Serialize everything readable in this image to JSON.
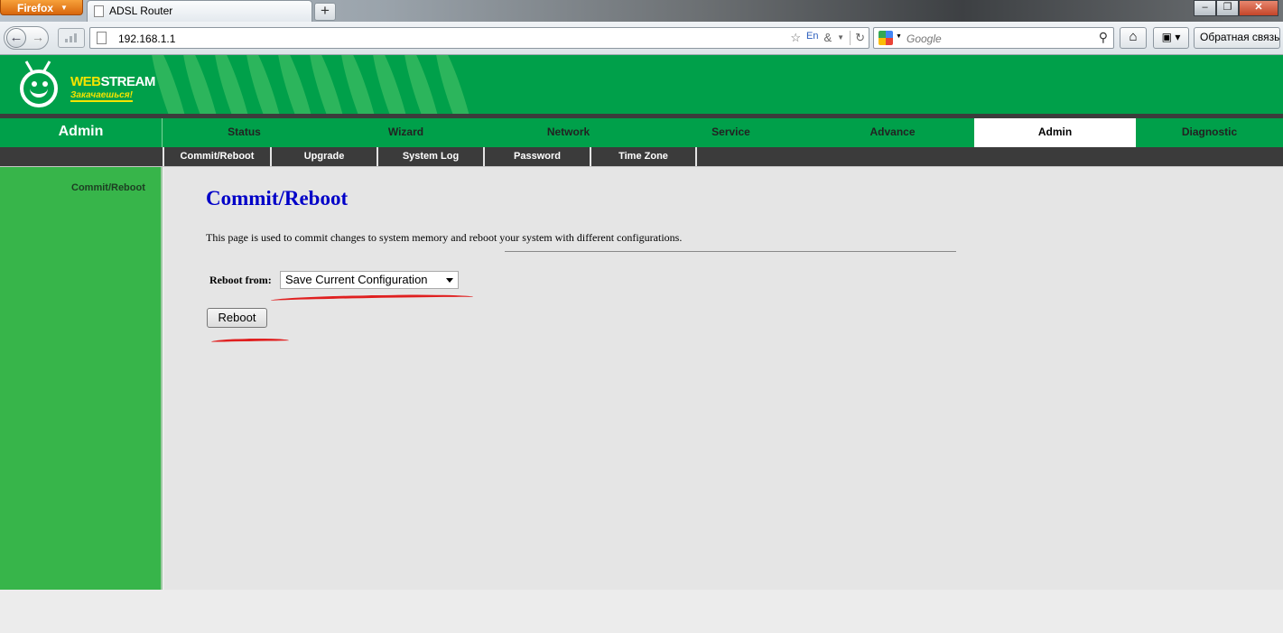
{
  "browser": {
    "menu_button": "Firefox",
    "tab_title": "ADSL Router",
    "new_tab": "+",
    "url": "192.168.1.1",
    "search_placeholder": "Google",
    "feedback_button": "Обратная связь",
    "window_controls": [
      "–",
      "❐",
      "✕"
    ]
  },
  "header": {
    "logo_web": "WEB",
    "logo_stream": "STREAM",
    "logo_tagline": "Закачаешься!",
    "brand_color": "#00a04a"
  },
  "sidebar": {
    "title": "Admin",
    "items": [
      {
        "label": "Commit/Reboot"
      }
    ]
  },
  "topnav": {
    "items": [
      {
        "label": "Status"
      },
      {
        "label": "Wizard"
      },
      {
        "label": "Network"
      },
      {
        "label": "Service"
      },
      {
        "label": "Advance"
      },
      {
        "label": "Admin",
        "active": true
      },
      {
        "label": "Diagnostic"
      }
    ]
  },
  "subnav": {
    "items": [
      {
        "label": "Commit/Reboot"
      },
      {
        "label": "Upgrade"
      },
      {
        "label": "System Log"
      },
      {
        "label": "Password"
      },
      {
        "label": "Time Zone"
      }
    ]
  },
  "main": {
    "title": "Commit/Reboot",
    "description": "This page is used to commit changes to system memory and reboot your system with different configurations.",
    "reboot_from_label": "Reboot from:",
    "reboot_from_value": "Save Current Configuration",
    "reboot_button": "Reboot",
    "title_color": "#0000c8",
    "annotation_color": "#e02020"
  }
}
